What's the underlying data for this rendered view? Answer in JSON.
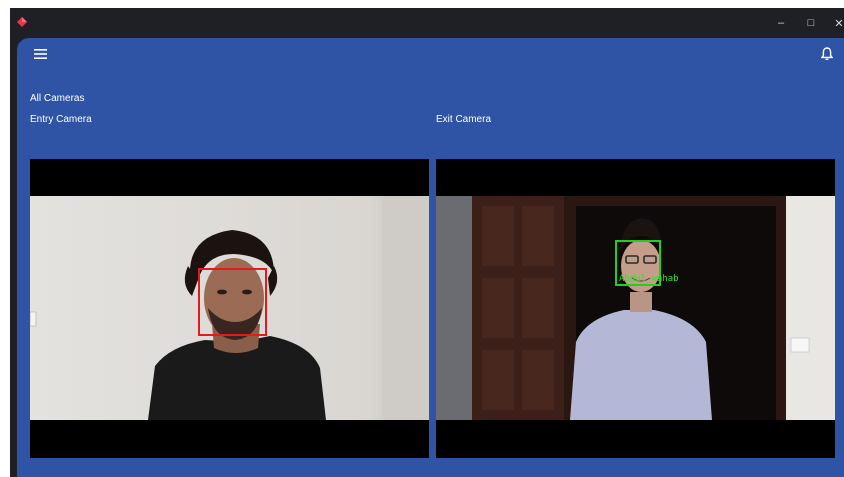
{
  "window": {
    "minimize_glyph": "–",
    "maximize_glyph": "□",
    "close_glyph": "✕"
  },
  "header": {
    "menu_icon": "hamburger-menu-icon",
    "notification_icon": "bell-icon"
  },
  "page": {
    "section_title": "All Cameras"
  },
  "cameras": [
    {
      "label": "Entry Camera",
      "detection_color": "#e31b1b",
      "detection_label": ""
    },
    {
      "label": "Exit Camera",
      "detection_color": "#20d020",
      "detection_label": "Abdul wahab"
    }
  ],
  "colors": {
    "app_background": "#2f54a6",
    "titlebar": "#1e2025"
  }
}
